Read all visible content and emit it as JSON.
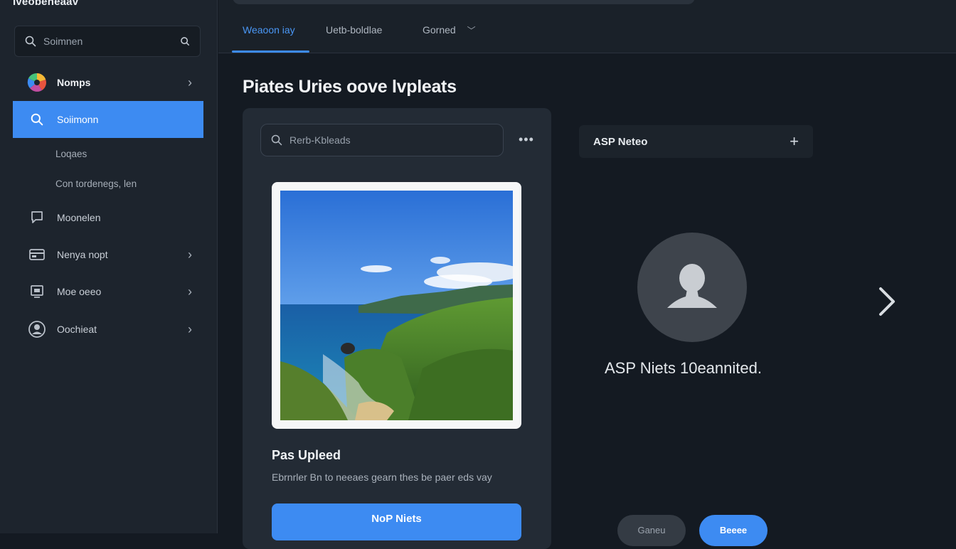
{
  "app": {
    "title": "Iveobeneaav"
  },
  "sidebar": {
    "search_placeholder": "Soimnen",
    "items": [
      {
        "label": "Nomps",
        "icon": "color-wheel-icon",
        "chevron": true
      },
      {
        "label": "Soiimonn",
        "icon": "search-icon",
        "active": true
      },
      {
        "label": "Moonelen",
        "icon": "chat-icon"
      },
      {
        "label": "Nenya nopt",
        "icon": "card-icon",
        "chevron": true
      },
      {
        "label": "Moe oeeo",
        "icon": "monitor-icon",
        "chevron": true
      },
      {
        "label": "Oochieat",
        "icon": "user-circle-icon",
        "chevron": true
      }
    ],
    "sub_items": [
      "Loqaes",
      "Con tordenegs, len"
    ]
  },
  "topbar": {
    "tabs": [
      {
        "label": "Weaoon iay",
        "active": true
      },
      {
        "label": "Uetb-boldlae"
      },
      {
        "label": "Gorned",
        "dropdown": true
      }
    ]
  },
  "main": {
    "title": "Piates Uries oove lvpleats",
    "card": {
      "search_placeholder": "Rerb-Kbleads",
      "heading": "Pas Upleed",
      "description": "Ebrnrler Bn to neeaes gearn thes be paer eds vay",
      "button_label": "NoP Niets"
    }
  },
  "panel": {
    "header": "ASP Neteo",
    "empty_text": "ASP Niets 10eannited.",
    "secondary_button": "Ganeu",
    "primary_button": "Beeee"
  },
  "colors": {
    "accent": "#3d8bf2",
    "background": "#141a22",
    "sidebar": "#1d242d",
    "card": "#232b35"
  }
}
